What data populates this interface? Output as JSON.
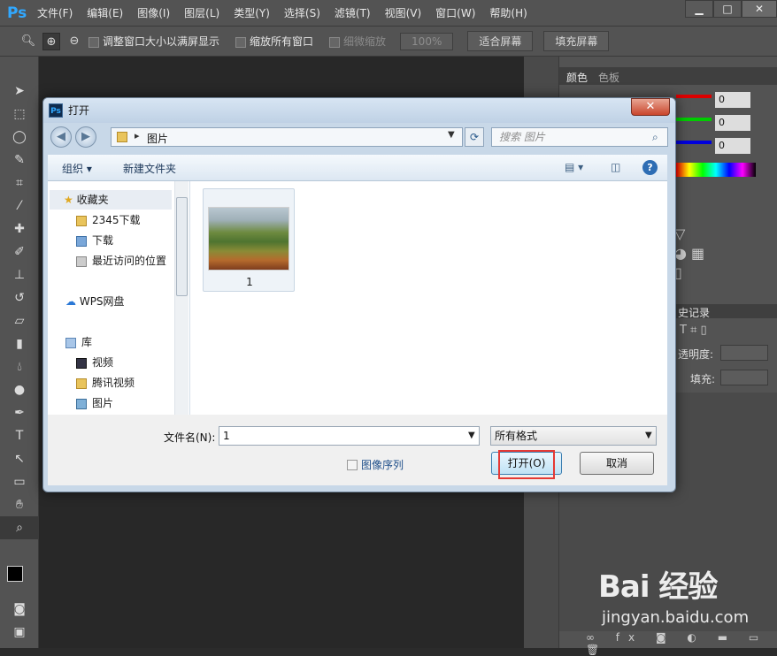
{
  "app": {
    "logo": "Ps",
    "menu": [
      "文件(F)",
      "编辑(E)",
      "图像(I)",
      "图层(L)",
      "类型(Y)",
      "选择(S)",
      "滤镜(T)",
      "视图(V)",
      "窗口(W)",
      "帮助(H)"
    ],
    "window_controls": {
      "minimize": "▁",
      "maximize": "□",
      "close": "✕"
    }
  },
  "options_bar": {
    "resize_windows": "调整窗口大小以满屏显示",
    "zoom_all_windows": "缩放所有窗口",
    "scrubby_zoom": "细微缩放",
    "zoom_percent": "100%",
    "fit_screen": "适合屏幕",
    "fill_screen": "填充屏幕"
  },
  "panels": {
    "color_tab": "颜色",
    "swatches_tab": "色板",
    "rgb_values": [
      "0",
      "0",
      "0"
    ],
    "history_tab": "史记录",
    "opacity_label": "透明度:",
    "fill_label": "填充:"
  },
  "dialog": {
    "title": "打开",
    "breadcrumb_sep": "▸",
    "breadcrumb": "图片",
    "search_placeholder": "搜索 图片",
    "organize": "组织 ▾",
    "new_folder": "新建文件夹",
    "nav": {
      "favorites": "收藏夹",
      "fav_items": [
        "2345下载",
        "下载",
        "最近访问的位置"
      ],
      "wps": "WPS网盘",
      "library": "库",
      "lib_items": [
        "视频",
        "腾讯视频",
        "图片"
      ]
    },
    "file": {
      "name": "1"
    },
    "filename_label": "文件名(N):",
    "filename_value": "1",
    "filetype_value": "所有格式",
    "image_sequence": "图像序列",
    "open_button": "打开(O)",
    "cancel_button": "取消"
  },
  "watermark": {
    "text": "Bai 经验",
    "url": "jingyan.baidu.com"
  }
}
